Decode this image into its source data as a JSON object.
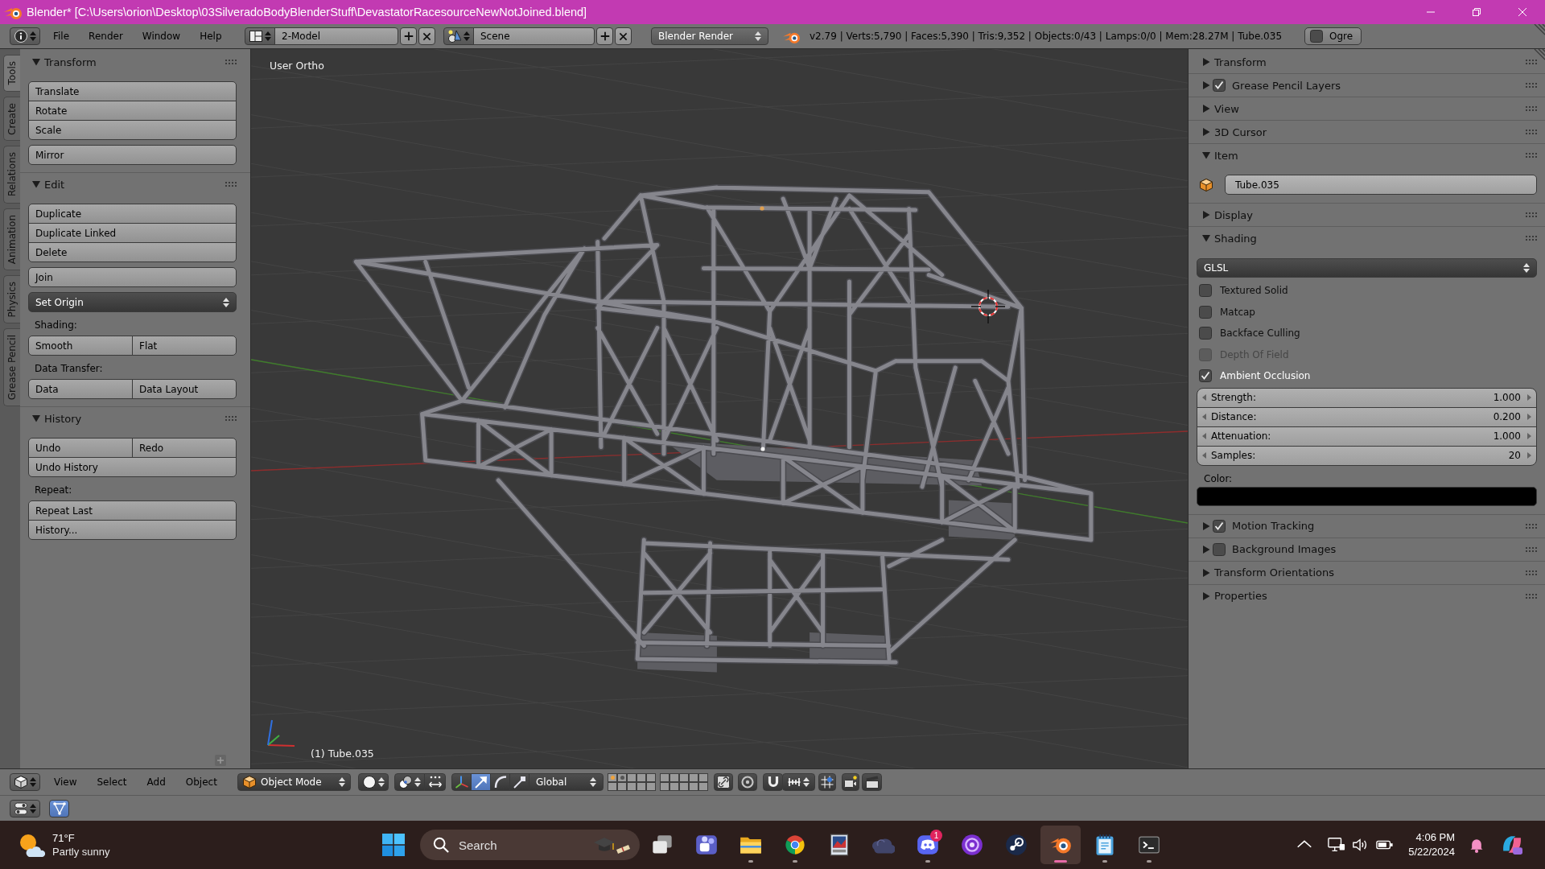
{
  "window": {
    "title": "Blender* [C:\\Users\\orion\\Desktop\\03SilveradoBodyBlenderStuff\\DevastatorRacesourceNewNotJoined.blend]"
  },
  "info_header": {
    "menus": [
      "File",
      "Render",
      "Window",
      "Help"
    ],
    "screen_layout": "2-Model",
    "scene": "Scene",
    "render_engine": "Blender Render",
    "stats": "v2.79 | Verts:5,790 | Faces:5,390 | Tris:9,352 | Objects:0/43 | Lamps:0/0 | Mem:28.27M | Tube.035",
    "ogre": {
      "label": "Ogre",
      "checked": false
    }
  },
  "tool_tabs": [
    {
      "label": "Tools",
      "selected": true
    },
    {
      "label": "Create",
      "selected": false
    },
    {
      "label": "Relations",
      "selected": false
    },
    {
      "label": "Animation",
      "selected": false
    },
    {
      "label": "Physics",
      "selected": false
    },
    {
      "label": "Grease Pencil",
      "selected": false
    }
  ],
  "tool_panels": [
    {
      "title": "Transform",
      "expanded": true,
      "items": [
        {
          "kind": "block",
          "rows": [
            [
              "Translate"
            ],
            [
              "Rotate"
            ],
            [
              "Scale"
            ]
          ]
        },
        {
          "kind": "block",
          "rows": [
            [
              "Mirror"
            ]
          ]
        }
      ]
    },
    {
      "title": "Edit",
      "expanded": true,
      "items": [
        {
          "kind": "block",
          "rows": [
            [
              "Duplicate"
            ],
            [
              "Duplicate Linked"
            ],
            [
              "Delete"
            ]
          ]
        },
        {
          "kind": "block",
          "rows": [
            [
              "Join"
            ]
          ]
        },
        {
          "kind": "dropdown",
          "label": "Set Origin"
        },
        {
          "kind": "label",
          "text": "Shading:"
        },
        {
          "kind": "block",
          "rows": [
            [
              "Smooth",
              "Flat"
            ]
          ]
        },
        {
          "kind": "label",
          "text": "Data Transfer:"
        },
        {
          "kind": "block",
          "rows": [
            [
              "Data",
              "Data Layout"
            ]
          ]
        }
      ]
    },
    {
      "title": "History",
      "expanded": true,
      "items": [
        {
          "kind": "block",
          "rows": [
            [
              "Undo",
              "Redo"
            ],
            [
              "Undo History"
            ]
          ]
        },
        {
          "kind": "label",
          "text": "Repeat:"
        },
        {
          "kind": "block",
          "rows": [
            [
              "Repeat Last"
            ],
            [
              "History..."
            ]
          ]
        }
      ]
    }
  ],
  "viewport": {
    "view_name": "User Ortho",
    "object_info": "(1) Tube.035"
  },
  "properties_panels": [
    {
      "title": "Transform",
      "expanded": false
    },
    {
      "title": "Grease Pencil Layers",
      "expanded": false,
      "checked": true
    },
    {
      "title": "View",
      "expanded": false
    },
    {
      "title": "3D Cursor",
      "expanded": false
    },
    {
      "title": "Item",
      "expanded": true,
      "items": [
        {
          "kind": "name",
          "value": "Tube.035"
        }
      ]
    },
    {
      "title": "Display",
      "expanded": false
    },
    {
      "title": "Shading",
      "expanded": true,
      "items": [
        {
          "kind": "dropdown",
          "label": "GLSL"
        },
        {
          "kind": "checkbox",
          "label": "Textured Solid",
          "checked": false,
          "disabled": false
        },
        {
          "kind": "checkbox",
          "label": "Matcap",
          "checked": false,
          "disabled": false
        },
        {
          "kind": "checkbox",
          "label": "Backface Culling",
          "checked": false,
          "disabled": false
        },
        {
          "kind": "checkbox",
          "label": "Depth Of Field",
          "checked": false,
          "disabled": true
        },
        {
          "kind": "checkbox",
          "label": "Ambient Occlusion",
          "checked": true,
          "disabled": false
        },
        {
          "kind": "numbers",
          "fields": [
            {
              "label": "Strength:",
              "value": "1.000"
            },
            {
              "label": "Distance:",
              "value": "0.200"
            },
            {
              "label": "Attenuation:",
              "value": "1.000"
            },
            {
              "label": "Samples:",
              "value": "20"
            }
          ]
        },
        {
          "kind": "label",
          "text": "Color:"
        },
        {
          "kind": "color",
          "color": "#000000"
        }
      ]
    },
    {
      "title": "Motion Tracking",
      "expanded": false,
      "checked": true
    },
    {
      "title": "Background Images",
      "expanded": false,
      "checked": false
    },
    {
      "title": "Transform Orientations",
      "expanded": false
    },
    {
      "title": "Properties",
      "expanded": false
    }
  ],
  "view3d_header": {
    "menus": [
      "View",
      "Select",
      "Add",
      "Object"
    ],
    "mode": "Object Mode",
    "manipulators": [
      {
        "kind": "axes",
        "selected": false
      },
      {
        "kind": "translate",
        "selected": true
      },
      {
        "kind": "rotate",
        "selected": false
      },
      {
        "kind": "scale",
        "selected": false
      }
    ],
    "orientation": "Global",
    "layers": [
      {
        "kind": "active_object"
      },
      {
        "kind": "objects"
      },
      {
        "kind": "empty"
      },
      {
        "kind": "empty"
      },
      {
        "kind": "empty"
      },
      {
        "kind": "empty"
      },
      {
        "kind": "empty"
      },
      {
        "kind": "empty"
      },
      {
        "kind": "empty"
      },
      {
        "kind": "empty"
      },
      {
        "kind": "empty"
      },
      {
        "kind": "empty"
      },
      {
        "kind": "empty"
      },
      {
        "kind": "empty"
      },
      {
        "kind": "empty"
      },
      {
        "kind": "empty"
      },
      {
        "kind": "empty"
      },
      {
        "kind": "empty"
      },
      {
        "kind": "empty"
      },
      {
        "kind": "empty"
      }
    ]
  },
  "timeline_header": {
    "toggle": {
      "selected": true
    }
  },
  "taskbar": {
    "weather": {
      "temperature": "71°F",
      "condition": "Partly sunny"
    },
    "search": {
      "placeholder": "Search"
    },
    "apps": [
      {
        "kind": "task_view",
        "running": false,
        "active": false
      },
      {
        "kind": "people",
        "running": false,
        "active": false
      },
      {
        "kind": "folder",
        "running": true,
        "active": false
      },
      {
        "kind": "segmented_circle",
        "running": true,
        "active": false
      },
      {
        "kind": "picture",
        "running": false,
        "active": false
      },
      {
        "kind": "cloud",
        "running": false,
        "active": false
      },
      {
        "kind": "gamepad",
        "running": true,
        "active": false,
        "badge": "1"
      },
      {
        "kind": "orb",
        "running": false,
        "active": false
      },
      {
        "kind": "disc",
        "running": false,
        "active": false
      },
      {
        "kind": "ring_logo",
        "running": true,
        "active": true
      },
      {
        "kind": "notepad",
        "running": true,
        "active": false
      },
      {
        "kind": "terminal",
        "running": true,
        "active": false
      }
    ],
    "tray": {
      "time": "4:06 PM",
      "date": "5/22/2024"
    }
  }
}
